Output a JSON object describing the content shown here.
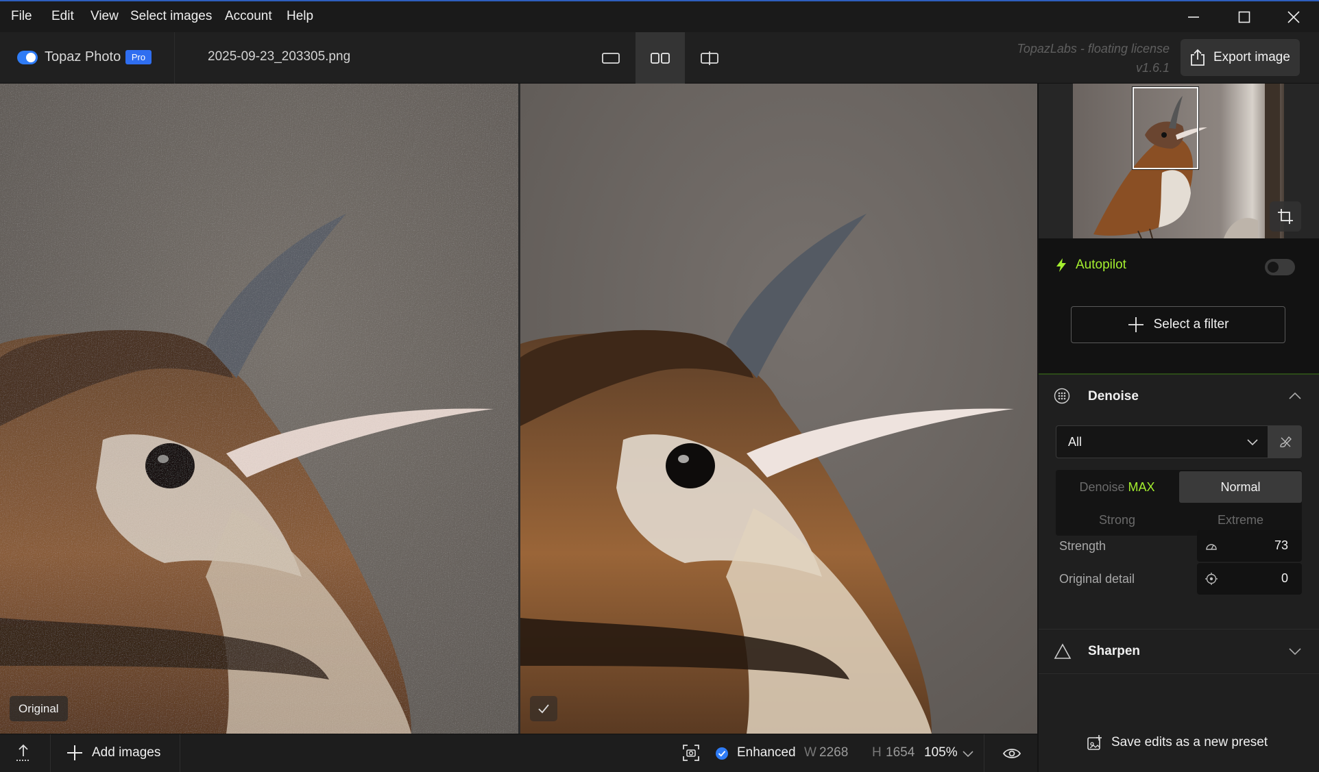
{
  "menu": {
    "items": [
      "File",
      "Edit",
      "View",
      "Select images",
      "Account",
      "Help"
    ]
  },
  "header": {
    "app_name": "Topaz Photo",
    "plan_badge": "Pro",
    "filename": "2025-09-23_203305.png",
    "license_line1": "TopazLabs - floating license",
    "license_line2": "v1.6.1",
    "export_label": "Export image",
    "active_view": "side-by-side"
  },
  "canvas": {
    "left_badge": "Original",
    "right_badge_icon": "checkmark-icon"
  },
  "bottombar": {
    "add_images_label": "Add images",
    "status_label": "Enhanced",
    "width_prefix": "W",
    "width_value": "2268",
    "height_prefix": "H",
    "height_value": "1654",
    "zoom": "105%"
  },
  "panel": {
    "autopilot": {
      "label": "Autopilot",
      "enabled": false
    },
    "select_filter_label": "Select a filter",
    "denoise": {
      "title": "Denoise",
      "subject_select": "All",
      "modes": [
        {
          "label": "Denoise ",
          "highlight": "MAX",
          "active": false
        },
        {
          "label": "Normal",
          "active": true
        },
        {
          "label": "Strong",
          "active": false
        },
        {
          "label": "Extreme",
          "active": false
        }
      ],
      "strength_label": "Strength",
      "strength_value": "73",
      "original_detail_label": "Original detail",
      "original_detail_value": "0"
    },
    "sharpen": {
      "title": "Sharpen"
    },
    "save_preset_label": "Save edits as a new preset"
  },
  "colors": {
    "accent_blue": "#2f7cf6",
    "autopilot_green": "#a4ef2f",
    "panel_bg": "#1f1f1f"
  }
}
